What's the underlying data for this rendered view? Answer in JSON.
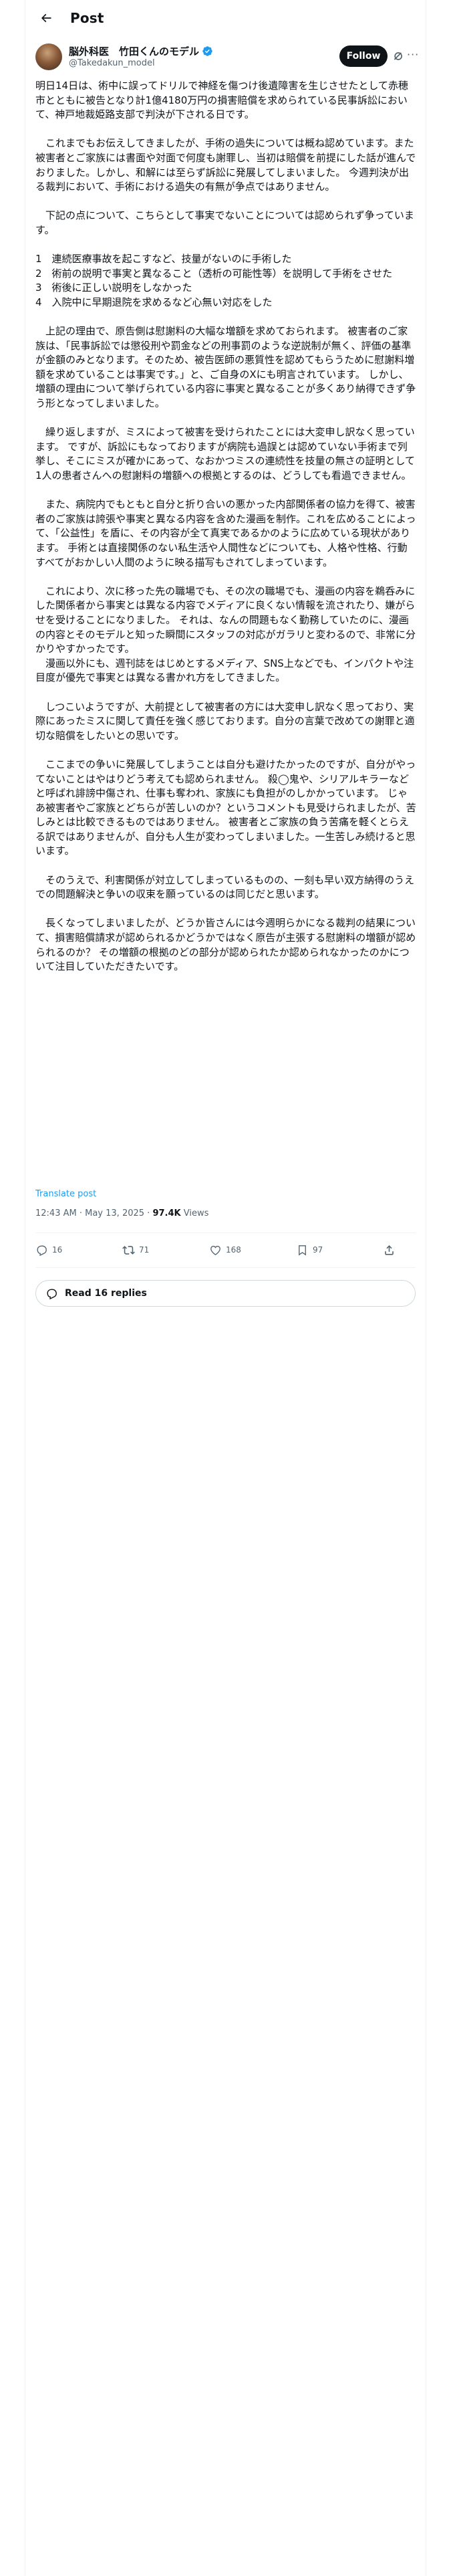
{
  "header": {
    "title": "Post",
    "back_icon": "arrow-left-icon"
  },
  "author": {
    "name": "脳外科医　竹田くんのモデル",
    "handle": "@Takedakun_model",
    "verified_color": "#1d9bf0",
    "follow_label": "Follow",
    "grok_icon": "grok-icon",
    "more_icon": "more-horizontal-icon"
  },
  "post": {
    "paragraphs": [
      "明日14日は、術中に誤ってドリルで神経を傷つけ後遺障害を生じさせたとして赤穂市とともに被告となり計1億4180万円の損害賠償を求められている民事訴訟において、神戸地裁姫路支部で判決が下される日です。",
      "これまでもお伝えしてきましたが、手術の過失については概ね認めています。また被害者とご家族には書面や対面で何度も謝罪し、当初は賠償を前提にした話が進んでおりました。しかし、和解には至らず訴訟に発展してしまいました。 今週判決が出る裁判において、手術における過失の有無が争点ではありません。",
      "下記の点について、こちらとして事実でないことについては認められず争っています。",
      "1　連続医療事故を起こすなど、技量がないのに手術した\n2　術前の説明で事実と異なること（透析の可能性等）を説明して手術をさせた\n3　術後に正しい説明をしなかった\n4　入院中に早期退院を求めるなど心無い対応をした",
      "上記の理由で、原告側は慰謝料の大幅な増額を求めておられます。 被害者のご家族は、「民事訴訟では懲役刑や罰金などの刑事罰のような逆説制が無く、評価の基準が金額のみとなります。そのため、被告医師の悪質性を認めてもらうために慰謝料増額を求めていることは事実です。」と、ご自身のXにも明言されています。 しかし、増額の理由について挙げられている内容に事実と異なることが多くあり納得できず争う形となってしまいました。",
      "繰り返しますが、ミスによって被害を受けられたことには大変申し訳なく思っています。 ですが、訴訟にもなっておりますが病院も過誤とは認めていない手術まで列挙し、そこにミスが確かにあって、なおかつミスの連続性を技量の無さの証明として1人の患者さんへの慰謝料の増額への根拠とするのは、どうしても看過できません。",
      "また、病院内でもともと自分と折り合いの悪かった内部関係者の協力を得て、被害者のご家族は誇張や事実と異なる内容を含めた漫画を制作。これを広めることによって、「公益性」を盾に、その内容が全て真実であるかのように広めている現状があります。 手術とは直接関係のない私生活や人間性などについても、人格や性格、行動すべてがおかしい人間のように映る描写もされてしまっています。",
      "これにより、次に移った先の職場でも、その次の職場でも、漫画の内容を鵜呑みにした関係者から事実とは異なる内容でメディアに良くない情報を流されたり、嫌がらせを受けることになりました。 それは、なんの問題もなく勤務していたのに、漫画の内容とそのモデルと知った瞬間にスタッフの対応がガラリと変わるので、非常に分かりやすかったです。\n　漫画以外にも、週刊誌をはじめとするメディア、SNS上などでも、インパクトや注目度が優先で事実とは異なる書かれ方をしてきました。",
      "しつこいようですが、大前提として被害者の方には大変申し訳なく思っており、実際にあったミスに関して責任を強く感じております。自分の言葉で改めての謝罪と適切な賠償をしたいとの思いです。",
      "ここまでの争いに発展してしまうことは自分も避けたかったのですが、自分がやってないことはやはりどう考えても認められません。 殺◯鬼や、シリアルキラーなどと呼ばれ誹謗中傷され、仕事も奪われ、家族にも負担がのしかかっています。 じゃあ被害者やご家族とどちらが苦しいのか？というコメントも見受けられましたが、苦しみとは比較できるものではありません。 被害者とご家族の負う苦痛を軽くとらえる訳ではありませんが、自分も人生が変わってしまいました。一生苦しみ続けると思います。",
      "そのうえで、利害関係が対立してしまっているものの、一刻も早い双方納得のうえでの問題解決と争いの収束を願っているのは同じだと思います。",
      "長くなってしまいましたが、どうか皆さんには今週明らかになる裁判の結果について、損害賠償請求が認められるかどうかではなく原告が主張する慰謝料の増額が認められるのか？ その増額の根拠のどの部分が認められたか認められなかったのかについて注目していただきたいです。"
    ],
    "translate_label": "Translate post",
    "time": "12:43 AM",
    "date": "May 13, 2025",
    "views_count": "97.4K",
    "views_label": "Views"
  },
  "actions": {
    "replies": "16",
    "reposts": "71",
    "likes": "168",
    "bookmarks": "97"
  },
  "read_replies_label": "Read 16 replies"
}
